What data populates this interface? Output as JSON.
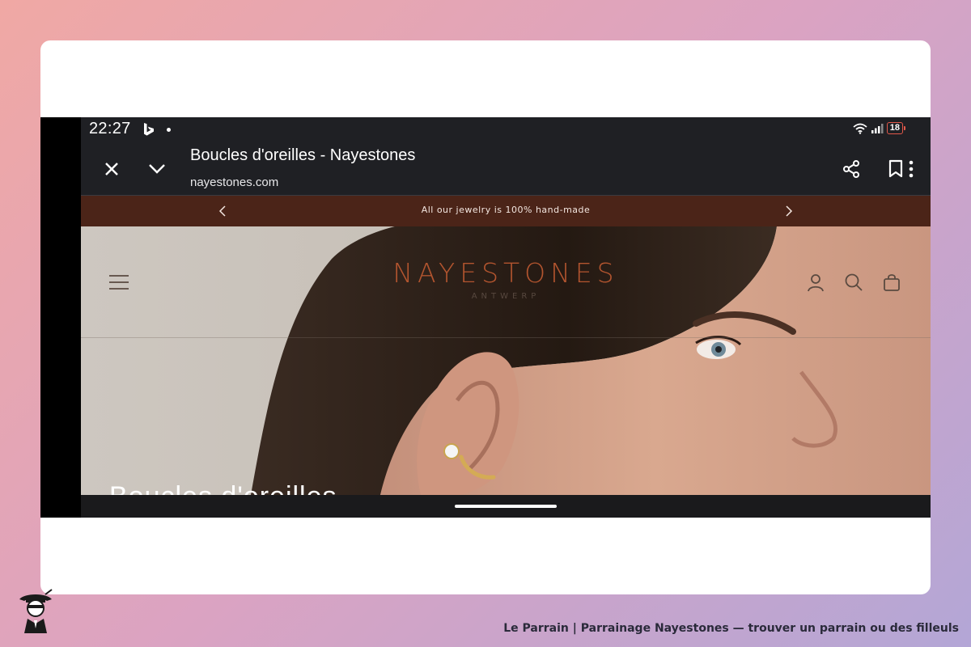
{
  "status_bar": {
    "time": "22:27",
    "battery": "18"
  },
  "browser": {
    "page_title": "Boucles d'oreilles - Nayestones",
    "url": "nayestones.com"
  },
  "announcement": {
    "text": "All our jewelry is 100% hand-made"
  },
  "site": {
    "logo": "NAYESTONES",
    "logo_sub": "ANTWERP",
    "hero_heading": "Boucles d'oreilles"
  },
  "footer": {
    "caption": "Le Parrain | Parrainage Nayestones — trouver un parrain ou des filleuls"
  },
  "colors": {
    "announcement_bg": "#4b2418",
    "logo": "#b3552f",
    "browser_bar": "#1f2024"
  },
  "icons": [
    "close-icon",
    "chevron-down-icon",
    "share-icon",
    "bookmark-icon",
    "more-vert-icon",
    "wifi-icon",
    "signal-icon",
    "battery-icon",
    "bing-icon",
    "hamburger-menu-icon",
    "account-icon",
    "search-icon",
    "shopping-bag-icon",
    "chevron-left-icon",
    "chevron-right-icon"
  ]
}
